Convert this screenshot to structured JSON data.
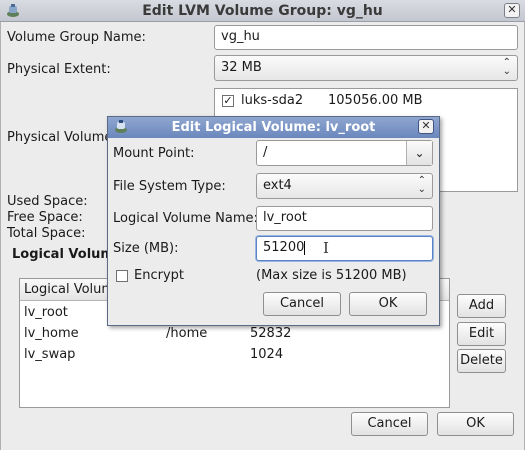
{
  "window": {
    "title": "Edit LVM Volume Group: vg_hu",
    "close_glyph": "✕"
  },
  "form": {
    "vg_name_label": "Volume Group Name:",
    "vg_name_value": "vg_hu",
    "pe_label": "Physical Extent:",
    "pe_value": "32 MB",
    "pv_label": "Physical Volume",
    "used_space_label": "Used Space:",
    "free_space_label": "Free Space:",
    "total_space_label": "Total Space:",
    "lv_section_label": "Logical Volum"
  },
  "physical_volumes": [
    {
      "checked": "✓",
      "name": "luks-sda2",
      "size": "105056.00 MB"
    }
  ],
  "lv_table": {
    "header": "Logical Volum",
    "rows": [
      {
        "name": "lv_root",
        "mount": "",
        "size": ""
      },
      {
        "name": "lv_home",
        "mount": "/home",
        "size": "52832"
      },
      {
        "name": "lv_swap",
        "mount": "",
        "size": "1024"
      }
    ]
  },
  "side_buttons": {
    "add": "Add",
    "edit": "Edit",
    "delete": "Delete"
  },
  "footer": {
    "cancel": "Cancel",
    "ok": "OK"
  },
  "dialog": {
    "title": "Edit Logical Volume: lv_root",
    "close_glyph": "✕",
    "mount_point_label": "Mount Point:",
    "mount_point_value": "/",
    "fs_type_label": "File System Type:",
    "fs_type_value": "ext4",
    "lv_name_label": "Logical Volume Name:",
    "lv_name_value": "lv_root",
    "size_label": "Size (MB):",
    "size_value": "51200",
    "encrypt_label": "Encrypt",
    "max_size_text": "(Max size is 51200 MB)",
    "cancel": "Cancel",
    "ok": "OK"
  },
  "icons": {
    "app_icon": "lvm-app-icon",
    "combo_arrow": "chevron-down-icon",
    "spin_arrows": "up-down-icon",
    "text_cursor": "ibeam-cursor-icon"
  }
}
